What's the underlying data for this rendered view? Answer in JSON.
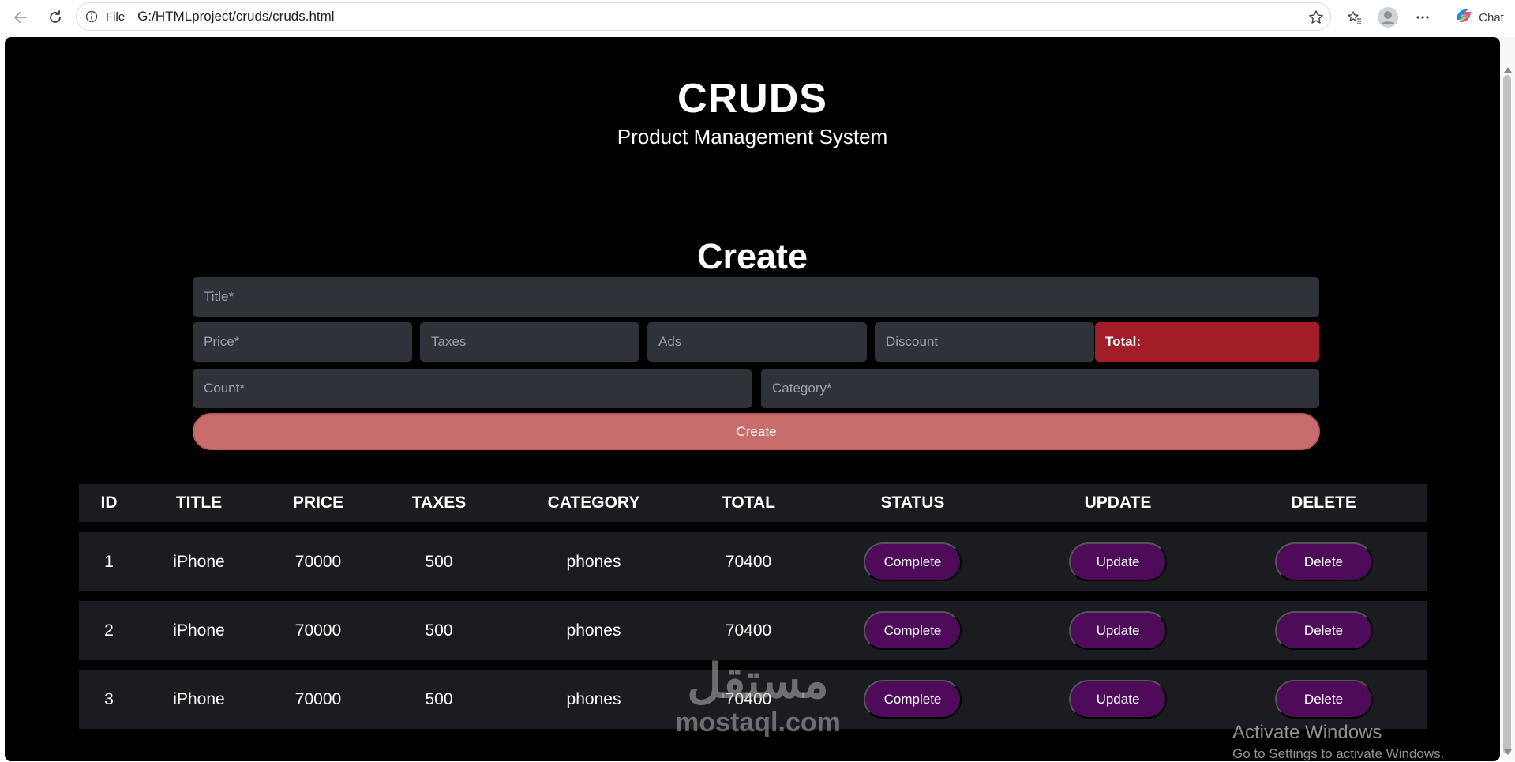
{
  "browser": {
    "scheme": "File",
    "url": "G:/HTMLproject/cruds/cruds.html",
    "chat_label": "Chat",
    "icons": [
      "back-icon",
      "reload-icon",
      "info-icon",
      "star-icon",
      "favorites-icon",
      "profile-icon",
      "more-icon",
      "copilot-icon"
    ]
  },
  "header": {
    "title": "CRUDS",
    "subtitle": "Product Management System"
  },
  "form": {
    "heading": "Create",
    "title_placeholder": "Title*",
    "price_placeholder": "Price*",
    "taxes_placeholder": "Taxes",
    "ads_placeholder": "Ads",
    "discount_placeholder": "Discount",
    "total_label": "Total:",
    "total_value": "",
    "count_placeholder": "Count*",
    "category_placeholder": "Category*",
    "create_button": "Create"
  },
  "table": {
    "columns": [
      "ID",
      "TITLE",
      "PRICE",
      "TAXES",
      "CATEGORY",
      "TOTAL",
      "STATUS",
      "UPDATE",
      "DELETE"
    ],
    "rows": [
      {
        "id": "1",
        "title": "iPhone",
        "price": "70000",
        "taxes": "500",
        "category": "phones",
        "total": "70400",
        "status": "Complete",
        "update": "Update",
        "delete": "Delete"
      },
      {
        "id": "2",
        "title": "iPhone",
        "price": "70000",
        "taxes": "500",
        "category": "phones",
        "total": "70400",
        "status": "Complete",
        "update": "Update",
        "delete": "Delete"
      },
      {
        "id": "3",
        "title": "iPhone",
        "price": "70000",
        "taxes": "500",
        "category": "phones",
        "total": "70400",
        "status": "Complete",
        "update": "Update",
        "delete": "Delete"
      }
    ]
  },
  "overlays": {
    "watermark_arabic": "مستقل",
    "watermark_latin": "mostaql.com",
    "activate_title": "Activate Windows",
    "activate_sub": "Go to Settings to activate Windows."
  },
  "colors": {
    "page_bg": "#000000",
    "input_bg": "#2f3239",
    "total_bg": "#a31d28",
    "create_btn": "#c86c6c",
    "table_bg": "#1a1c20",
    "pill_bg": "#4d0b5a"
  }
}
